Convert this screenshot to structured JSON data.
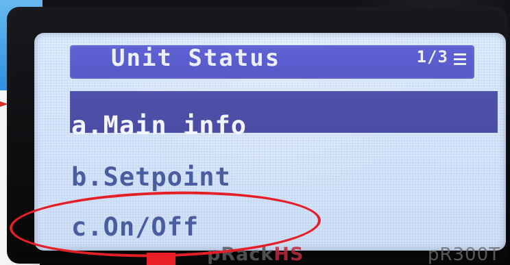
{
  "screen": {
    "title": "Unit Status",
    "page": "1/3",
    "menu_items": [
      "a.Main info",
      "b.Setpoint",
      "c.On/Off"
    ]
  },
  "footer": {
    "brand_prefix": "pRack",
    "brand_suffix": "HS",
    "model": "pR300T"
  },
  "icons": {
    "menu": "menu-icon",
    "annotation_arrow": "annotation-arrow"
  },
  "colors": {
    "screen_bg": "#d8e9fc",
    "header_bg": "#5f62d6",
    "selected_bg": "#4e4faa",
    "text_primary": "#485c9e",
    "text_inverse": "#f2f5ff",
    "annotation_red": "#e51f27",
    "corner_blue": "#2e8fe1"
  }
}
